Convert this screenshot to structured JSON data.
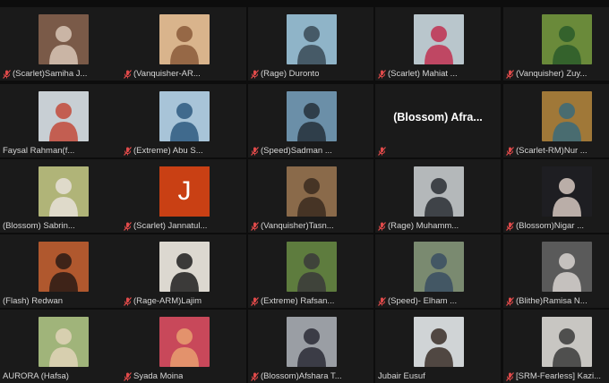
{
  "meeting": {
    "participants": [
      {
        "name": "(Scarlet)Samiha J...",
        "muted": true,
        "tile": "photo",
        "bg": "#7a5a48",
        "fg": "#d8c6b6"
      },
      {
        "name": "(Vanquisher-AR...",
        "muted": true,
        "tile": "photo",
        "bg": "#d9b48c",
        "fg": "#8a5a3a"
      },
      {
        "name": "(Rage) Duronto",
        "muted": true,
        "tile": "photo",
        "bg": "#8fb4c8",
        "fg": "#3a4a56"
      },
      {
        "name": "(Scarlet) Mahiat ...",
        "muted": true,
        "tile": "photo",
        "bg": "#b9c6cc",
        "fg": "#c03050"
      },
      {
        "name": "(Vanquisher) Zuy...",
        "muted": true,
        "tile": "photo",
        "bg": "#6a8a3a",
        "fg": "#2a5a2a"
      },
      {
        "name": "Faysal Rahman(f...",
        "muted": false,
        "tile": "photo",
        "bg": "#c8cfd4",
        "fg": "#c24a3a"
      },
      {
        "name": "(Extreme) Abu S...",
        "muted": true,
        "tile": "photo",
        "bg": "#a8c4d8",
        "fg": "#2e5a80"
      },
      {
        "name": "(Speed)Sadman ...",
        "muted": true,
        "tile": "photo",
        "bg": "#6b8fa8",
        "fg": "#24303a"
      },
      {
        "name": "",
        "muted": true,
        "tile": "name",
        "display_name": "(Blossom) Afra..."
      },
      {
        "name": "(Scarlet-RM)Nur ...",
        "muted": true,
        "tile": "photo",
        "bg": "#a07838",
        "fg": "#3a6a7a"
      },
      {
        "name": "(Blossom) Sabrin...",
        "muted": false,
        "tile": "photo",
        "bg": "#b0b478",
        "fg": "#e8e0d8"
      },
      {
        "name": "(Scarlet) Jannatul...",
        "muted": true,
        "tile": "initial",
        "initial": "J",
        "bg": "#c94014"
      },
      {
        "name": "(Vanquisher)Tasn...",
        "muted": true,
        "tile": "photo",
        "bg": "#8a6a4a",
        "fg": "#3a2a1e"
      },
      {
        "name": "(Rage) Muhamm...",
        "muted": true,
        "tile": "photo",
        "bg": "#b4b8ba",
        "fg": "#2a2e34"
      },
      {
        "name": "(Blossom)Nigar ...",
        "muted": true,
        "tile": "photo",
        "bg": "#1e1e22",
        "fg": "#d6c8c0"
      },
      {
        "name": "(Flash) Redwan",
        "muted": false,
        "tile": "photo",
        "bg": "#b0582e",
        "fg": "#2a1a14"
      },
      {
        "name": "(Rage-ARM)Lajim",
        "muted": true,
        "tile": "photo",
        "bg": "#dcd8d0",
        "fg": "#1e1e1e"
      },
      {
        "name": "(Extreme) Rafsan...",
        "muted": true,
        "tile": "photo",
        "bg": "#5e7c3e",
        "fg": "#3a3a3a"
      },
      {
        "name": "(Speed)- Elham ...",
        "muted": true,
        "tile": "photo",
        "bg": "#7a8a70",
        "fg": "#3a4e62"
      },
      {
        "name": "(Blithe)Ramisa N...",
        "muted": true,
        "tile": "photo",
        "bg": "#5a5a5a",
        "fg": "#d8d4d0"
      },
      {
        "name": "AURORA (Hafsa)",
        "muted": false,
        "tile": "photo",
        "bg": "#a0b47a",
        "fg": "#e0d4b8"
      },
      {
        "name": "Syada Moina",
        "muted": true,
        "tile": "photo",
        "bg": "#c8485a",
        "fg": "#e8a070"
      },
      {
        "name": "(Blossom)Afshara T...",
        "muted": true,
        "tile": "photo",
        "bg": "#9a9ea4",
        "fg": "#2a2a36"
      },
      {
        "name": "Jubair Eusuf",
        "muted": false,
        "tile": "photo",
        "bg": "#d0d4d6",
        "fg": "#3a2e28"
      },
      {
        "name": "[SRM-Fearless] Kazi...",
        "muted": true,
        "tile": "photo",
        "bg": "#c8c6c2",
        "fg": "#3a3a3a"
      }
    ]
  }
}
